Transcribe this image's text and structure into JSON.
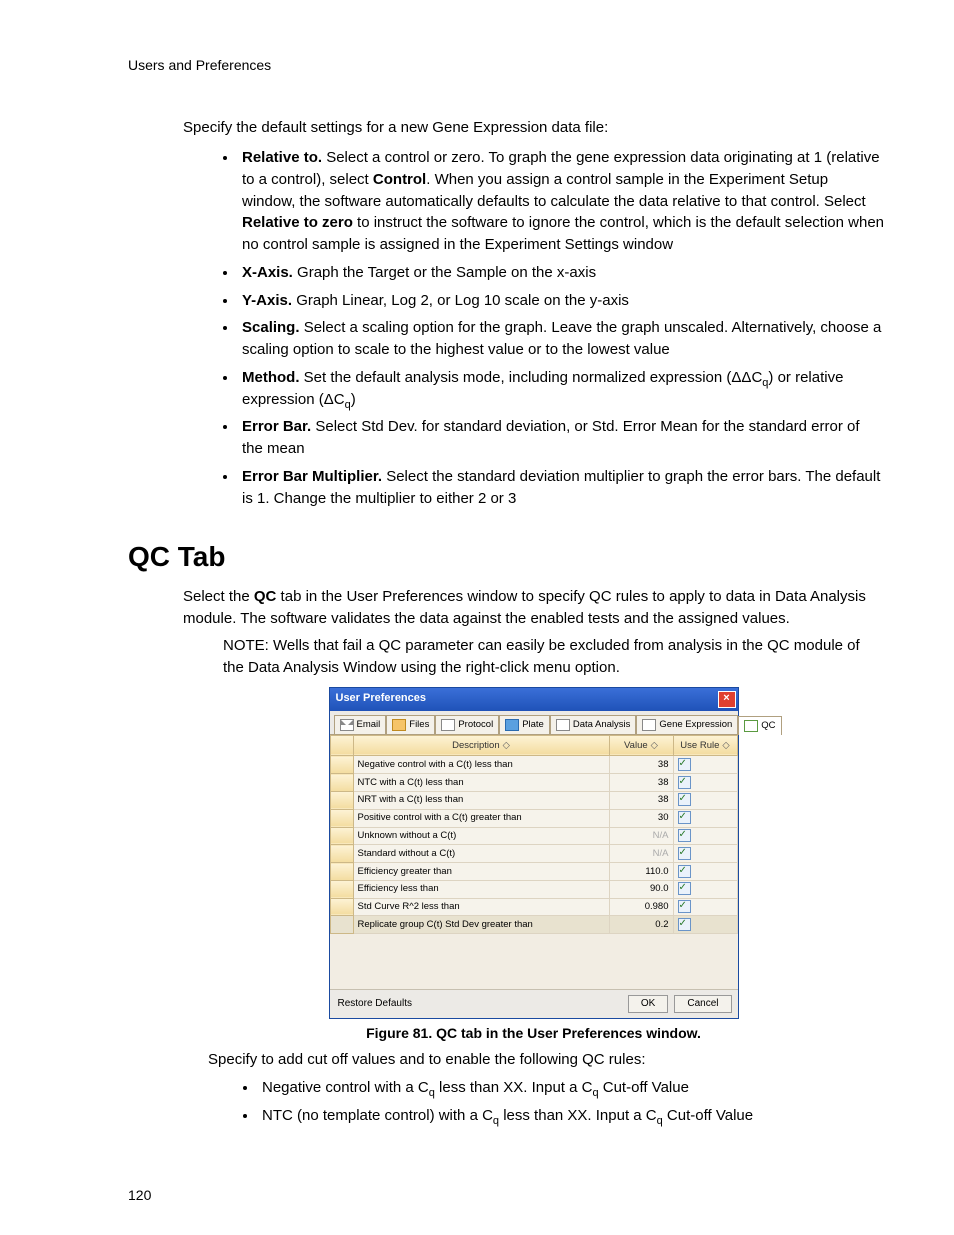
{
  "header": {
    "section": "Users and Preferences"
  },
  "intro": "Specify the default settings for a new Gene Expression data file:",
  "bullets": [
    {
      "term": "Relative to.",
      "text": " Select a control or zero. To graph the gene expression data originating at 1 (relative to a control), select ",
      "bold2": "Control",
      "text2": ". When you assign a control sample in the Experiment Setup window, the software automatically defaults to calculate the data relative to that control. Select ",
      "bold3": "Relative to zero",
      "text3": " to instruct the software to ignore the control, which is the default selection when no control sample is assigned in the Experiment Settings window"
    },
    {
      "term": "X-Axis.",
      "text": " Graph the Target or the Sample on the x-axis"
    },
    {
      "term": "Y-Axis.",
      "text": " Graph Linear, Log 2, or Log 10 scale on the y-axis"
    },
    {
      "term": "Scaling.",
      "text": " Select a scaling option for the graph. Leave the graph unscaled. Alternatively, choose a scaling option to scale to the highest value or to the lowest value"
    },
    {
      "term": "Method.",
      "text_html": " Set the default analysis mode, including normalized expression (ΔΔC<sub>q</sub>) or relative expression (ΔC<sub>q</sub>)"
    },
    {
      "term": "Error Bar.",
      "text": " Select Std Dev. for standard deviation, or Std. Error Mean for the standard error of the mean"
    },
    {
      "term": "Error Bar Multiplier.",
      "text": " Select the standard deviation multiplier to graph the error bars. The default is 1. Change the multiplier to either 2 or 3"
    }
  ],
  "qc_heading": "QC Tab",
  "qc_para_parts": {
    "p1a": "Select the ",
    "p1b": "QC",
    "p1c": " tab in the User Preferences window to specify QC rules to apply to data in Data Analysis module. The software validates the data against the enabled tests and the assigned values."
  },
  "qc_note": "NOTE: Wells that fail a QC parameter can easily be excluded from analysis in the QC module of the Data Analysis Window using the right-click menu option.",
  "dialog": {
    "title": "User Preferences",
    "tabs": [
      "Email",
      "Files",
      "Protocol",
      "Plate",
      "Data Analysis",
      "Gene Expression",
      "QC"
    ],
    "active_tab": "QC",
    "columns": {
      "desc": "Description",
      "value": "Value",
      "use": "Use Rule"
    },
    "rows": [
      {
        "desc": "Negative control with a C(t) less than",
        "value": "38",
        "na": false,
        "checked": true,
        "sel": false
      },
      {
        "desc": "NTC with a C(t) less than",
        "value": "38",
        "na": false,
        "checked": true,
        "sel": false
      },
      {
        "desc": "NRT with a C(t) less than",
        "value": "38",
        "na": false,
        "checked": true,
        "sel": false
      },
      {
        "desc": "Positive control with a C(t) greater than",
        "value": "30",
        "na": false,
        "checked": true,
        "sel": false
      },
      {
        "desc": "Unknown without a C(t)",
        "value": "N/A",
        "na": true,
        "checked": true,
        "sel": false
      },
      {
        "desc": "Standard without a C(t)",
        "value": "N/A",
        "na": true,
        "checked": true,
        "sel": false
      },
      {
        "desc": "Efficiency greater than",
        "value": "110.0",
        "na": false,
        "checked": true,
        "sel": false
      },
      {
        "desc": "Efficiency less than",
        "value": "90.0",
        "na": false,
        "checked": true,
        "sel": false
      },
      {
        "desc": "Std Curve R^2 less than",
        "value": "0.980",
        "na": false,
        "checked": true,
        "sel": false
      },
      {
        "desc": "Replicate group C(t) Std Dev greater than",
        "value": "0.2",
        "na": false,
        "checked": true,
        "sel": true
      }
    ],
    "footer": {
      "restore": "Restore Defaults",
      "ok": "OK",
      "cancel": "Cancel"
    }
  },
  "figure_caption": "Figure 81. QC tab in the User Preferences window.",
  "post_para": "Specify to add cut off values and to enable the following QC rules:",
  "post_bullets": [
    "Negative control with a C<sub>q</sub> less than XX. Input a C<sub>q</sub> Cut-off Value",
    "NTC (no template control) with a C<sub>q</sub> less than XX. Input a C<sub>q</sub> Cut-off Value"
  ],
  "page_number": "120"
}
